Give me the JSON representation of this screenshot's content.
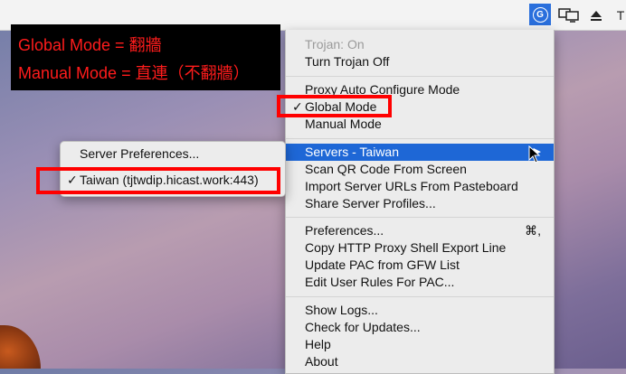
{
  "annotation": {
    "line1": "Global Mode = 翻牆",
    "line2": "Manual Mode = 直連（不翻牆）"
  },
  "menubar": {
    "icons": [
      "shadowsocks-g-icon",
      "display-icon",
      "eject-icon"
    ],
    "trailing_char": "T"
  },
  "menu": {
    "status": "Trojan: On",
    "toggle": "Turn Trojan Off",
    "modes": [
      "Proxy Auto Configure Mode",
      "Global Mode",
      "Manual Mode"
    ],
    "checked_mode": "Global Mode",
    "servers": "Servers - Taiwan",
    "scan_qr": "Scan QR Code From Screen",
    "import_urls": "Import Server URLs From Pasteboard",
    "share_profiles": "Share Server Profiles...",
    "preferences": "Preferences...",
    "preferences_shortcut": "⌘,",
    "copy_proxy": "Copy HTTP Proxy Shell Export Line",
    "update_pac": "Update PAC from GFW List",
    "edit_rules": "Edit User Rules For PAC...",
    "show_logs": "Show Logs...",
    "check_updates": "Check for Updates...",
    "help": "Help",
    "about": "About"
  },
  "submenu": {
    "server_prefs": "Server Preferences...",
    "server_entry": "Taiwan (tjtwdip.hicast.work:443)",
    "check_mark": "✓"
  },
  "colors": {
    "highlight": "#1e67d6",
    "annotation_text": "#ff1c1c",
    "annotation_box": "#ff0000"
  }
}
